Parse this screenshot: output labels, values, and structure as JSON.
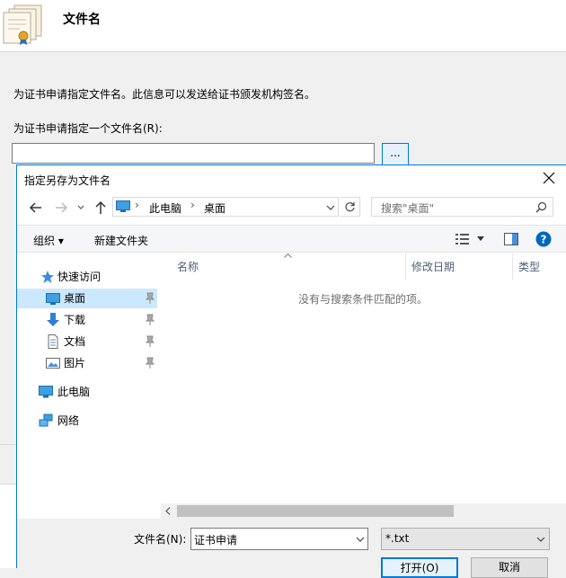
{
  "wizard": {
    "title": "文件名",
    "description": "为证书申请指定文件名。此信息可以发送给证书颁发机构签名。",
    "field_label": "为证书申请指定一个文件名(R):",
    "field_value": "",
    "browse_label": "..."
  },
  "dialog": {
    "title": "指定另存为文件名",
    "breadcrumb": [
      "此电脑",
      "桌面"
    ],
    "search_placeholder": "搜索\"桌面\"",
    "toolbar": {
      "organize": "组织 ▾",
      "new_folder": "新建文件夹"
    },
    "nav": {
      "quick_access": "快速访问",
      "items": [
        {
          "label": "桌面",
          "icon": "desktop-icon",
          "pinned": true,
          "selected": true
        },
        {
          "label": "下载",
          "icon": "download-icon",
          "pinned": true
        },
        {
          "label": "文档",
          "icon": "document-icon",
          "pinned": true
        },
        {
          "label": "图片",
          "icon": "picture-icon",
          "pinned": true
        }
      ],
      "this_pc": "此电脑",
      "network": "网络"
    },
    "columns": [
      "名称",
      "修改日期",
      "类型"
    ],
    "empty_message": "没有与搜索条件匹配的项。",
    "filename_label": "文件名(N):",
    "filename_value": "证书申请",
    "filetype_value": "*.txt",
    "buttons": {
      "open": "打开(O)",
      "cancel": "取消"
    }
  },
  "colors": {
    "accent": "#0078d7",
    "selection": "#cce8ff",
    "help": "#0067c0"
  }
}
